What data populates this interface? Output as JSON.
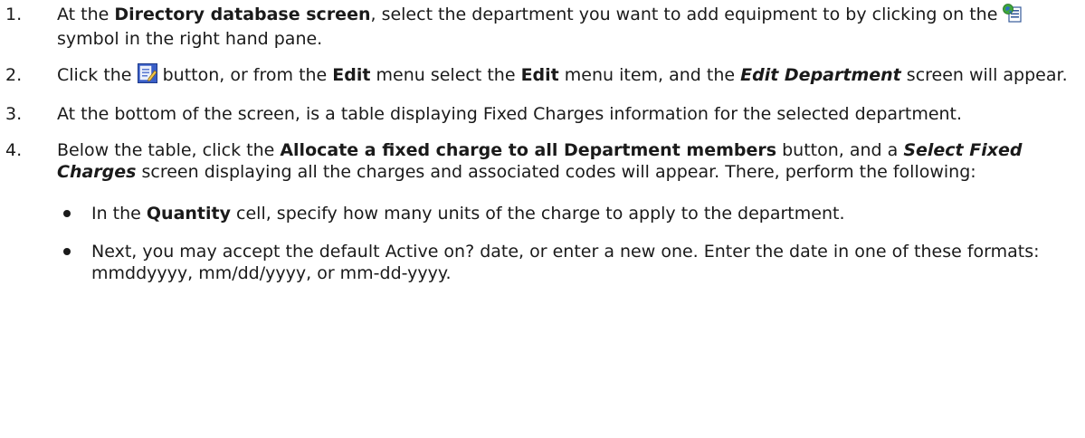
{
  "steps": [
    {
      "number": "1.",
      "t1": "At the ",
      "b1": "Directory database screen",
      "t2": ", select the department you want to add equipment to by clicking on the ",
      "icon": "directory-department-icon",
      "t3": " symbol in the right hand pane."
    },
    {
      "number": "2.",
      "t1": "Click the ",
      "icon": "edit-button-icon",
      "t2": " button, or from the ",
      "b1": "Edit",
      "t3": " menu select the ",
      "b2": "Edit",
      "t4": " menu item, and the ",
      "bi1": "Edit Department",
      "t5": " screen will appear."
    },
    {
      "number": "3.",
      "t1": "At the bottom of the screen, is a table displaying Fixed Charges information for the selected department."
    },
    {
      "number": "4.",
      "t1": "Below the table, click the ",
      "b1": "Allocate a fixed charge to all Department members",
      "t2": " button, and a ",
      "bi1": "Select Fixed Charges",
      "t3": " screen displaying all the charges and associated codes will appear. There, perform the following:",
      "bullets": [
        {
          "t1": "In the ",
          "b1": "Quantity",
          "t2": " cell, specify how many units of the charge to apply to the department."
        },
        {
          "t1": "Next, you may accept the default Active on? date, or enter a new one. Enter the date in one of these formats:  mmddyyyy, mm/dd/yyyy, or mm-dd-yyyy."
        }
      ]
    }
  ]
}
